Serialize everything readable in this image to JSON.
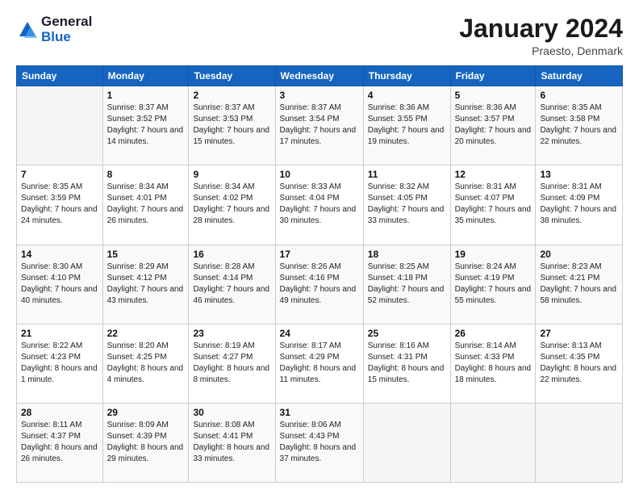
{
  "header": {
    "logo_general": "General",
    "logo_blue": "Blue",
    "month_title": "January 2024",
    "location": "Praesto, Denmark"
  },
  "days_of_week": [
    "Sunday",
    "Monday",
    "Tuesday",
    "Wednesday",
    "Thursday",
    "Friday",
    "Saturday"
  ],
  "weeks": [
    [
      {
        "day": "",
        "sunrise": "",
        "sunset": "",
        "daylight": ""
      },
      {
        "day": "1",
        "sunrise": "Sunrise: 8:37 AM",
        "sunset": "Sunset: 3:52 PM",
        "daylight": "Daylight: 7 hours and 14 minutes."
      },
      {
        "day": "2",
        "sunrise": "Sunrise: 8:37 AM",
        "sunset": "Sunset: 3:53 PM",
        "daylight": "Daylight: 7 hours and 15 minutes."
      },
      {
        "day": "3",
        "sunrise": "Sunrise: 8:37 AM",
        "sunset": "Sunset: 3:54 PM",
        "daylight": "Daylight: 7 hours and 17 minutes."
      },
      {
        "day": "4",
        "sunrise": "Sunrise: 8:36 AM",
        "sunset": "Sunset: 3:55 PM",
        "daylight": "Daylight: 7 hours and 19 minutes."
      },
      {
        "day": "5",
        "sunrise": "Sunrise: 8:36 AM",
        "sunset": "Sunset: 3:57 PM",
        "daylight": "Daylight: 7 hours and 20 minutes."
      },
      {
        "day": "6",
        "sunrise": "Sunrise: 8:35 AM",
        "sunset": "Sunset: 3:58 PM",
        "daylight": "Daylight: 7 hours and 22 minutes."
      }
    ],
    [
      {
        "day": "7",
        "sunrise": "Sunrise: 8:35 AM",
        "sunset": "Sunset: 3:59 PM",
        "daylight": "Daylight: 7 hours and 24 minutes."
      },
      {
        "day": "8",
        "sunrise": "Sunrise: 8:34 AM",
        "sunset": "Sunset: 4:01 PM",
        "daylight": "Daylight: 7 hours and 26 minutes."
      },
      {
        "day": "9",
        "sunrise": "Sunrise: 8:34 AM",
        "sunset": "Sunset: 4:02 PM",
        "daylight": "Daylight: 7 hours and 28 minutes."
      },
      {
        "day": "10",
        "sunrise": "Sunrise: 8:33 AM",
        "sunset": "Sunset: 4:04 PM",
        "daylight": "Daylight: 7 hours and 30 minutes."
      },
      {
        "day": "11",
        "sunrise": "Sunrise: 8:32 AM",
        "sunset": "Sunset: 4:05 PM",
        "daylight": "Daylight: 7 hours and 33 minutes."
      },
      {
        "day": "12",
        "sunrise": "Sunrise: 8:31 AM",
        "sunset": "Sunset: 4:07 PM",
        "daylight": "Daylight: 7 hours and 35 minutes."
      },
      {
        "day": "13",
        "sunrise": "Sunrise: 8:31 AM",
        "sunset": "Sunset: 4:09 PM",
        "daylight": "Daylight: 7 hours and 38 minutes."
      }
    ],
    [
      {
        "day": "14",
        "sunrise": "Sunrise: 8:30 AM",
        "sunset": "Sunset: 4:10 PM",
        "daylight": "Daylight: 7 hours and 40 minutes."
      },
      {
        "day": "15",
        "sunrise": "Sunrise: 8:29 AM",
        "sunset": "Sunset: 4:12 PM",
        "daylight": "Daylight: 7 hours and 43 minutes."
      },
      {
        "day": "16",
        "sunrise": "Sunrise: 8:28 AM",
        "sunset": "Sunset: 4:14 PM",
        "daylight": "Daylight: 7 hours and 46 minutes."
      },
      {
        "day": "17",
        "sunrise": "Sunrise: 8:26 AM",
        "sunset": "Sunset: 4:16 PM",
        "daylight": "Daylight: 7 hours and 49 minutes."
      },
      {
        "day": "18",
        "sunrise": "Sunrise: 8:25 AM",
        "sunset": "Sunset: 4:18 PM",
        "daylight": "Daylight: 7 hours and 52 minutes."
      },
      {
        "day": "19",
        "sunrise": "Sunrise: 8:24 AM",
        "sunset": "Sunset: 4:19 PM",
        "daylight": "Daylight: 7 hours and 55 minutes."
      },
      {
        "day": "20",
        "sunrise": "Sunrise: 8:23 AM",
        "sunset": "Sunset: 4:21 PM",
        "daylight": "Daylight: 7 hours and 58 minutes."
      }
    ],
    [
      {
        "day": "21",
        "sunrise": "Sunrise: 8:22 AM",
        "sunset": "Sunset: 4:23 PM",
        "daylight": "Daylight: 8 hours and 1 minute."
      },
      {
        "day": "22",
        "sunrise": "Sunrise: 8:20 AM",
        "sunset": "Sunset: 4:25 PM",
        "daylight": "Daylight: 8 hours and 4 minutes."
      },
      {
        "day": "23",
        "sunrise": "Sunrise: 8:19 AM",
        "sunset": "Sunset: 4:27 PM",
        "daylight": "Daylight: 8 hours and 8 minutes."
      },
      {
        "day": "24",
        "sunrise": "Sunrise: 8:17 AM",
        "sunset": "Sunset: 4:29 PM",
        "daylight": "Daylight: 8 hours and 11 minutes."
      },
      {
        "day": "25",
        "sunrise": "Sunrise: 8:16 AM",
        "sunset": "Sunset: 4:31 PM",
        "daylight": "Daylight: 8 hours and 15 minutes."
      },
      {
        "day": "26",
        "sunrise": "Sunrise: 8:14 AM",
        "sunset": "Sunset: 4:33 PM",
        "daylight": "Daylight: 8 hours and 18 minutes."
      },
      {
        "day": "27",
        "sunrise": "Sunrise: 8:13 AM",
        "sunset": "Sunset: 4:35 PM",
        "daylight": "Daylight: 8 hours and 22 minutes."
      }
    ],
    [
      {
        "day": "28",
        "sunrise": "Sunrise: 8:11 AM",
        "sunset": "Sunset: 4:37 PM",
        "daylight": "Daylight: 8 hours and 26 minutes."
      },
      {
        "day": "29",
        "sunrise": "Sunrise: 8:09 AM",
        "sunset": "Sunset: 4:39 PM",
        "daylight": "Daylight: 8 hours and 29 minutes."
      },
      {
        "day": "30",
        "sunrise": "Sunrise: 8:08 AM",
        "sunset": "Sunset: 4:41 PM",
        "daylight": "Daylight: 8 hours and 33 minutes."
      },
      {
        "day": "31",
        "sunrise": "Sunrise: 8:06 AM",
        "sunset": "Sunset: 4:43 PM",
        "daylight": "Daylight: 8 hours and 37 minutes."
      },
      {
        "day": "",
        "sunrise": "",
        "sunset": "",
        "daylight": ""
      },
      {
        "day": "",
        "sunrise": "",
        "sunset": "",
        "daylight": ""
      },
      {
        "day": "",
        "sunrise": "",
        "sunset": "",
        "daylight": ""
      }
    ]
  ]
}
